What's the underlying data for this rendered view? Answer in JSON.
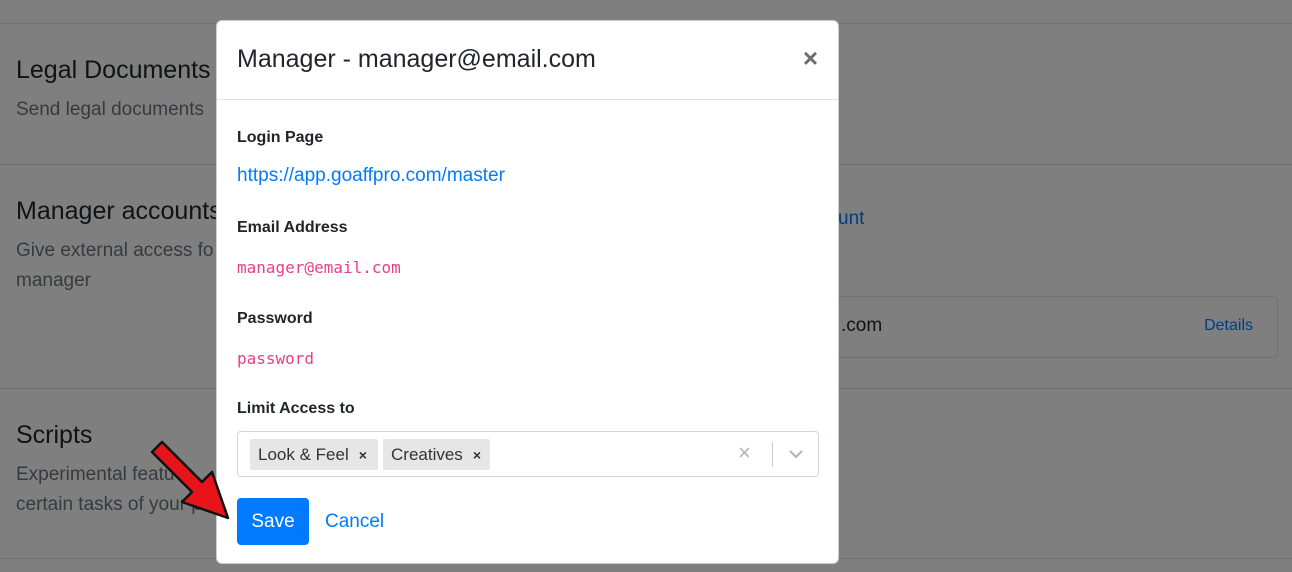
{
  "background": {
    "sections": [
      {
        "title": "Legal Documents",
        "desc": "Send legal documents"
      },
      {
        "title": "Manager accounts",
        "desc_line1": "Give external access fo",
        "desc_line2": "manager"
      },
      {
        "title": "Scripts",
        "desc_line1": "Experimental featu",
        "desc_line2": "certain tasks of your pr"
      }
    ],
    "add_account_link": "unt",
    "card": {
      "text": ".com",
      "link": "Details"
    }
  },
  "modal": {
    "title": "Manager - manager@email.com",
    "close": "×",
    "login_label": "Login Page",
    "login_url": "https://app.goaffpro.com/master",
    "email_label": "Email Address",
    "email_value": "manager@email.com",
    "password_label": "Password",
    "password_value": "password",
    "limit_label": "Limit Access to",
    "tags": [
      "Look & Feel",
      "Creatives"
    ],
    "tag_remove": "×",
    "clear": "×",
    "save_label": "Save",
    "cancel_label": "Cancel"
  },
  "colors": {
    "primary": "#007bff",
    "code": "#e83e8c",
    "annotation_arrow": "#e8141b"
  }
}
